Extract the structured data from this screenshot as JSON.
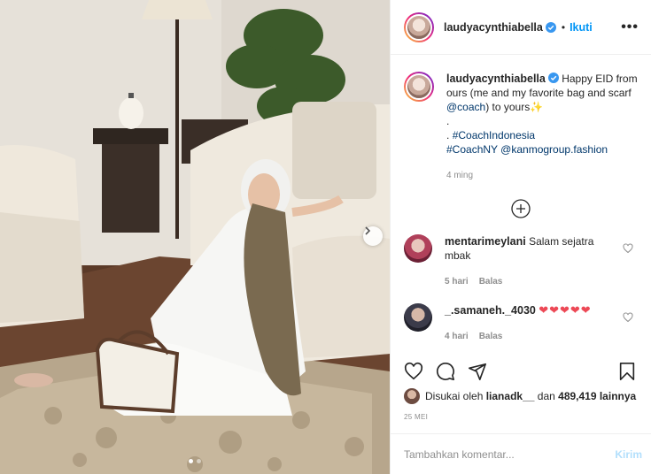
{
  "post": {
    "username": "laudyacynthiabella",
    "follow_label": "Ikuti",
    "separator": "•",
    "more_label": "•••",
    "caption": {
      "line1": "Happy EID from ours (me and my favorite bag and scarf ",
      "mention": "@coach",
      "line1_end": ") to yours",
      "emoji": "✨",
      "dot1": ".",
      "dot2": ".",
      "hashtag1": "#CoachIndonesia",
      "hashtag2": "#CoachNY",
      "mention2": "@kanmogroup.fashion",
      "time": "4 ming"
    },
    "comments": [
      {
        "username": "mentarimeylani",
        "text": "Salam sejatra mbak",
        "time": "5 hari",
        "reply": "Balas"
      },
      {
        "username": "_.samaneh._4030",
        "text": "❤❤❤❤❤",
        "time": "4 hari",
        "reply": "Balas"
      }
    ],
    "likes": {
      "prefix": "Disukai oleh",
      "user": "lianadk__",
      "conj": "dan",
      "count": "489,419 lainnya"
    },
    "date": "25 MEI",
    "add_comment_placeholder": "Tambahkan komentar...",
    "post_label": "Kirim"
  },
  "colors": {
    "accent": "#0095f6",
    "link": "#00376b",
    "like": "#ed4956",
    "muted": "#8e8e8e"
  },
  "icons": [
    "verified-badge-icon",
    "more-options-icon",
    "load-more-icon",
    "heart-icon",
    "comment-icon",
    "share-icon",
    "bookmark-icon",
    "carousel-next-icon"
  ]
}
